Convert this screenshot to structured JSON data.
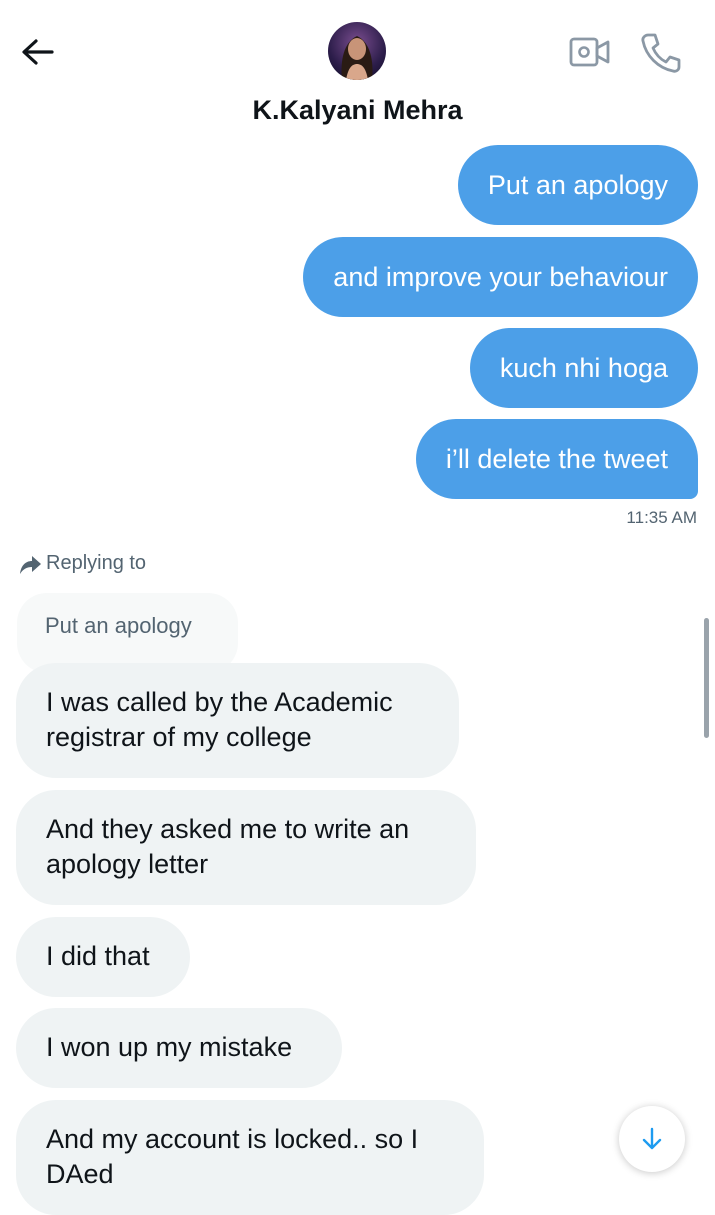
{
  "header": {
    "contact_name": "K.Kalyani Mehra",
    "icons": [
      "back-arrow-icon",
      "avatar",
      "video-camera-icon",
      "phone-icon"
    ]
  },
  "conversation": {
    "sent_messages": [
      "Put an apology",
      "and improve your behaviour",
      "kuch nhi hoga",
      "i’ll delete the tweet"
    ],
    "sent_time": "11:35 AM",
    "reply_context": {
      "label": "Replying to",
      "quoted_text": "Put an apology"
    },
    "received_messages": [
      "I was called by the Academic registrar of my college",
      "And they asked me to write an apology letter",
      "I did that",
      "I won up my mistake",
      "And my account is locked.. so I DAed"
    ]
  },
  "colors": {
    "sent_bubble": "#4c9fe8",
    "received_bubble": "#eff3f4",
    "secondary_text": "#536471"
  }
}
